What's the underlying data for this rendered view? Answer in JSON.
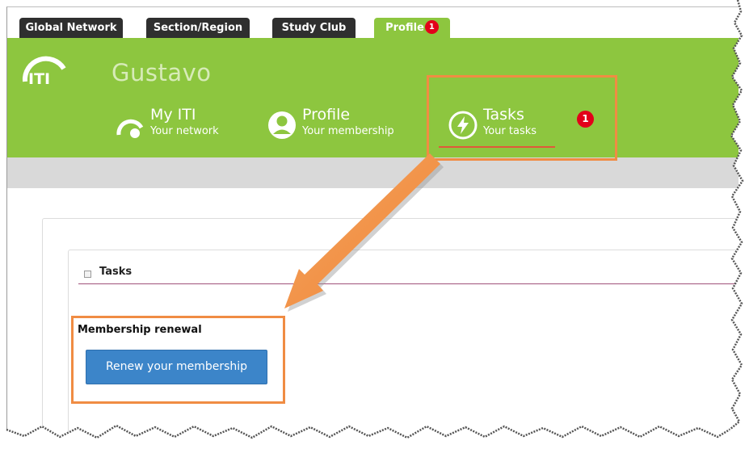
{
  "tabs": [
    {
      "label": "Global Network",
      "active": false
    },
    {
      "label": "Section/Region",
      "active": false
    },
    {
      "label": "Study Club",
      "active": false
    },
    {
      "label": "Profile",
      "active": true,
      "badge": "1"
    }
  ],
  "header": {
    "logo_text": "ITI",
    "username": "Gustavo",
    "nav": [
      {
        "title": "My ITI",
        "subtitle": "Your network",
        "icon": "network-icon"
      },
      {
        "title": "Profile",
        "subtitle": "Your membership",
        "icon": "user-icon"
      },
      {
        "title": "Tasks",
        "subtitle": "Your tasks",
        "icon": "lightning-icon",
        "badge": "1"
      }
    ]
  },
  "content": {
    "section_title": "Tasks",
    "renewal_title": "Membership renewal",
    "renew_button": "Renew your membership"
  },
  "colors": {
    "header_green": "#8dc63f",
    "tab_dark": "#2f2f2f",
    "badge_red": "#e2001a",
    "button_blue": "#3c85c9",
    "annotation_orange": "#f08c43"
  }
}
